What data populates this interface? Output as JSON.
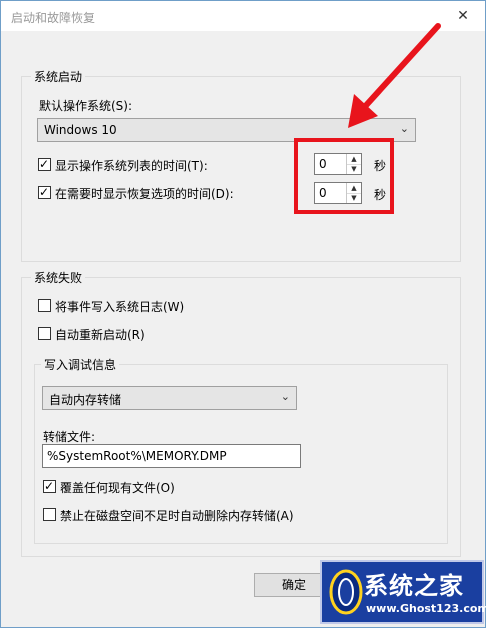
{
  "window": {
    "title": "启动和故障恢复",
    "close_symbol": "✕"
  },
  "startup": {
    "group_label": "系统启动",
    "default_os_label": "默认操作系统(S):",
    "default_os_value": "Windows 10",
    "show_list_time_label": "显示操作系统列表的时间(T):",
    "show_list_time_checked": true,
    "show_list_time_value": "0",
    "show_recovery_time_label": "在需要时显示恢复选项的时间(D):",
    "show_recovery_time_checked": true,
    "show_recovery_time_value": "0",
    "seconds_unit": "秒"
  },
  "failure": {
    "group_label": "系统失败",
    "write_event_log_label": "将事件写入系统日志(W)",
    "write_event_log_checked": false,
    "auto_restart_label": "自动重新启动(R)",
    "auto_restart_checked": false,
    "debug_group_label": "写入调试信息",
    "debug_type_value": "自动内存转储",
    "dump_file_label": "转储文件:",
    "dump_file_value": "%SystemRoot%\\MEMORY.DMP",
    "overwrite_label": "覆盖任何现有文件(O)",
    "overwrite_checked": true,
    "disable_autodelete_label": "禁止在磁盘空间不足时自动删除内存转储(A)",
    "disable_autodelete_checked": false
  },
  "buttons": {
    "ok_label": "确定"
  },
  "watermark": {
    "title": "系统之家",
    "url": "www.Ghost123.com"
  },
  "colors": {
    "highlight": "#e8141c",
    "watermark_bg": "#1a3fa0"
  }
}
